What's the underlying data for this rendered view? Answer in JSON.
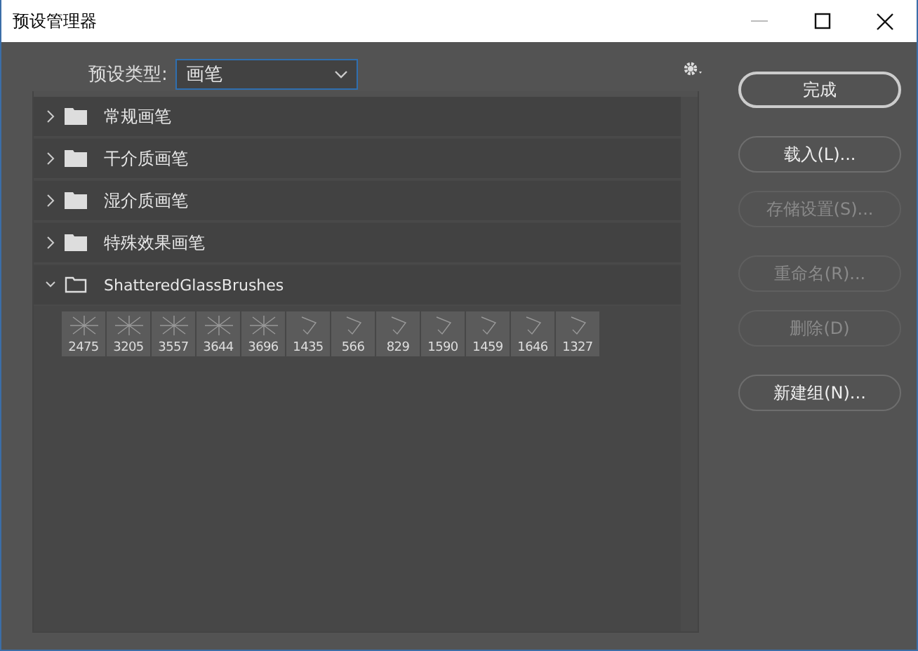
{
  "window": {
    "title": "预设管理器"
  },
  "preset_type": {
    "label": "预设类型:",
    "value": "画笔"
  },
  "groups": [
    {
      "name": "常规画笔",
      "expanded": false
    },
    {
      "name": "干介质画笔",
      "expanded": false
    },
    {
      "name": "湿介质画笔",
      "expanded": false
    },
    {
      "name": "特殊效果画笔",
      "expanded": false
    },
    {
      "name": "ShatteredGlassBrushes",
      "expanded": true,
      "brushes": [
        "2475",
        "3205",
        "3557",
        "3644",
        "3696",
        "1435",
        "566",
        "829",
        "1590",
        "1459",
        "1646",
        "1327"
      ]
    }
  ],
  "buttons": [
    {
      "label": "完成",
      "disabled": false,
      "kind": "primary"
    },
    {
      "label": "载入(L)...",
      "disabled": false,
      "kind": "normal"
    },
    {
      "label": "存储设置(S)...",
      "disabled": true,
      "kind": "normal"
    },
    {
      "label": "重命名(R)...",
      "disabled": true,
      "kind": "normal"
    },
    {
      "label": "删除(D)",
      "disabled": true,
      "kind": "normal"
    },
    {
      "label": "新建组(N)...",
      "disabled": false,
      "kind": "normal"
    }
  ]
}
